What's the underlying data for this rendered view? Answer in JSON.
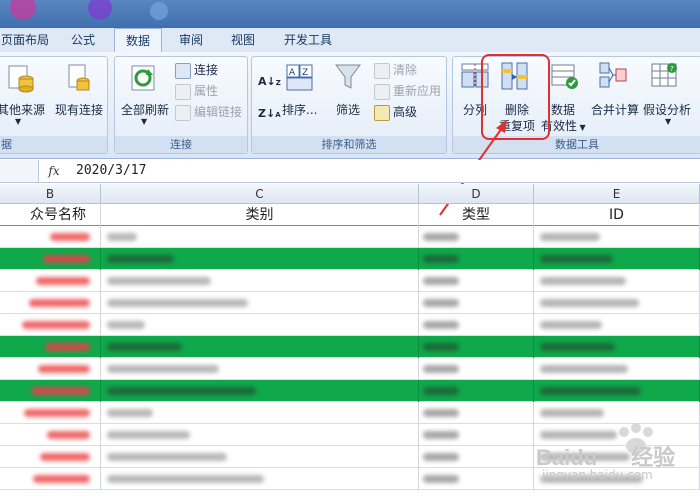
{
  "ribbon_tabs": [
    {
      "label": "页面布局"
    },
    {
      "label": "公式"
    },
    {
      "label": "数据"
    },
    {
      "label": "审阅"
    },
    {
      "label": "视图"
    },
    {
      "label": "开发工具"
    }
  ],
  "groups": {
    "get_external": {
      "label": "据",
      "other_sources": "其他来源",
      "existing_conn": "现有连接"
    },
    "connections": {
      "label": "连接",
      "refresh_all": "全部刷新",
      "connections": "连接",
      "properties": "属性",
      "edit_links": "编辑链接"
    },
    "sort_filter": {
      "label": "排序和筛选",
      "sort": "排序...",
      "filter": "筛选",
      "clear": "清除",
      "reapply": "重新应用",
      "advanced": "高级"
    },
    "data_tools": {
      "label": "数据工具",
      "text_to_columns": "分列",
      "remove_dup_line1": "删除",
      "remove_dup_line2": "重复项",
      "validation_line1": "数据",
      "validation_line2": "有效性",
      "consolidate": "合并计算",
      "what_if": "假设分析"
    }
  },
  "formula_bar": {
    "fx": "fx",
    "value": "2020/3/17"
  },
  "columns": [
    {
      "letter": "B"
    },
    {
      "letter": "C"
    },
    {
      "letter": "D"
    },
    {
      "letter": "E"
    }
  ],
  "header_row": {
    "b": "众号名称",
    "c": "类别",
    "d": "类型",
    "e": "ID"
  },
  "rows": [
    {
      "green": false
    },
    {
      "green": true
    },
    {
      "green": false
    },
    {
      "green": false
    },
    {
      "green": false
    },
    {
      "green": true
    },
    {
      "green": false
    },
    {
      "green": true
    },
    {
      "green": false
    },
    {
      "green": false
    },
    {
      "green": false
    },
    {
      "green": false
    }
  ],
  "colors": {
    "accent_red": "#e03030",
    "highlight_green": "#0fa84a",
    "tab_active_bg": "#eef4fb"
  },
  "watermark": {
    "brand": "Bai",
    "brand2": "经验",
    "url": "jingyan.baidu.com"
  }
}
